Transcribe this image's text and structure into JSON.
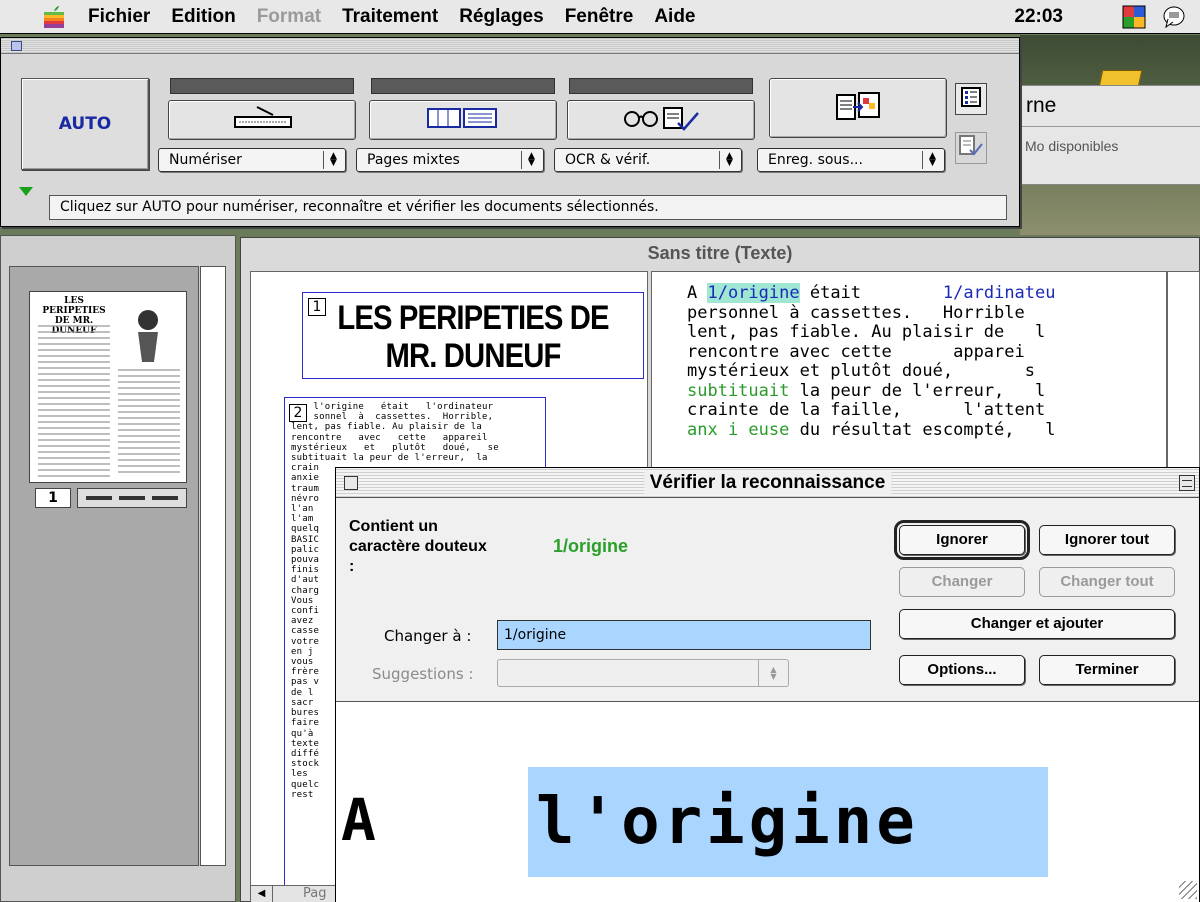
{
  "menubar": {
    "items": [
      {
        "label": "Fichier",
        "disabled": false
      },
      {
        "label": "Edition",
        "disabled": false
      },
      {
        "label": "Format",
        "disabled": true
      },
      {
        "label": "Traitement",
        "disabled": false
      },
      {
        "label": "Réglages",
        "disabled": false
      },
      {
        "label": "Fenêtre",
        "disabled": false
      },
      {
        "label": "Aide",
        "disabled": false
      }
    ],
    "clock": "22:03",
    "icons": [
      "apple-icon",
      "application-menu-icon",
      "help-balloon-icon"
    ]
  },
  "background_window": {
    "title": "rne",
    "subtitle": "Mo disponibles"
  },
  "toolbar": {
    "auto_label": "AUTO",
    "tools": [
      {
        "icon": "scanner-icon",
        "popup": "Numériser"
      },
      {
        "icon": "page-columns-icon",
        "popup": "Pages mixtes"
      },
      {
        "icon": "ocr-glasses-icon",
        "popup": "OCR & vérif."
      },
      {
        "icon": "save-export-icon",
        "popup": "Enreg. sous..."
      }
    ],
    "status": "Cliquez sur AUTO pour numériser, reconnaître et vérifier les documents sélectionnés."
  },
  "thumbnails": {
    "page_number": "1",
    "thumb_title": "LES PERIPETIES DE MR. DUNEUF"
  },
  "document": {
    "window_title": "Sans titre (Texte)",
    "zone1_label": "1",
    "zone1_text": "LES PERIPETIES DE\nMR. DUNEUF",
    "zone2_label": "2",
    "zone2_text": "    l'origine   était   l'ordinateur\n    sonnel  à  cassettes.  Horrible,\nlent, pas fiable. Au plaisir de la\nrencontre   avec   cette   appareil\nmystérieux   et   plutôt   doué,   se\nsubtituait la peur de l'erreur,  la\ncrain\nanxie\ntraum\nnévro\nl'an\nl'am\nquelq\nBASIC\npalic\npouva\nfinis\nd'aut\ncharg\nVous\nconfi\navez\ncasse\nvotre\nen j\nvous\nfrère\npas v\nde l\nsacr\nbures\nfaire\nqu'à\ntexte\ndiffé\nstock\nles\nquelc\nrest",
    "hscroll_label": "Pag",
    "text_lines": [
      [
        {
          "t": "A "
        },
        {
          "t": "1/origine",
          "c": "hl"
        },
        {
          "t": " était        "
        },
        {
          "t": "1/ardinateu",
          "c": "blue"
        }
      ],
      [
        {
          "t": "personnel à cassettes.   Horrible"
        }
      ],
      [
        {
          "t": "lent, pas fiable. Au plaisir de   l"
        }
      ],
      [
        {
          "t": "rencontre avec cette      apparei"
        }
      ],
      [
        {
          "t": "mystérieux et plutôt doué,       s"
        }
      ],
      [
        {
          "t": "subtituait",
          "c": "green"
        },
        {
          "t": " la peur de l'erreur,   l"
        }
      ],
      [
        {
          "t": "crainte de la faille,      l'attent"
        }
      ],
      [
        {
          "t": "anx i euse",
          "c": "green"
        },
        {
          "t": " du résultat escompté,   l"
        }
      ]
    ]
  },
  "verify": {
    "title": "Vérifier la reconnaissance",
    "doubt_label": "Contient un caractère douteux :",
    "doubt_word": "1/origine",
    "change_label": "Changer à :",
    "change_value": "1/origine",
    "suggestions_label": "Suggestions :",
    "buttons": {
      "ignore": "Ignorer",
      "ignore_all": "Ignorer tout",
      "change": "Changer",
      "change_all": "Changer tout",
      "change_add": "Changer et ajouter",
      "options": "Options...",
      "finish": "Terminer"
    },
    "preview_prefix": "A",
    "preview_word": "l'origine"
  }
}
